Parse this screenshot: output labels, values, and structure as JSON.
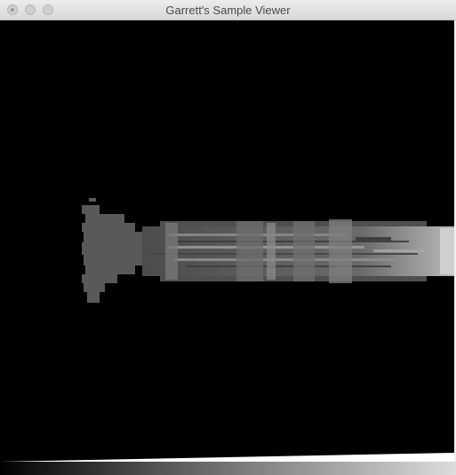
{
  "window": {
    "title": "Garrett's Sample Viewer"
  },
  "titlebar_buttons": [
    {
      "name": "close-button"
    },
    {
      "name": "minimize-button"
    },
    {
      "name": "zoom-button"
    }
  ],
  "viewer": {
    "background": "#000000",
    "content": "grayscale rendered sample"
  },
  "colors": {
    "canvas_background": "#000000",
    "titlebar": "#e3e3e3",
    "title_text": "#4a4a4a"
  }
}
